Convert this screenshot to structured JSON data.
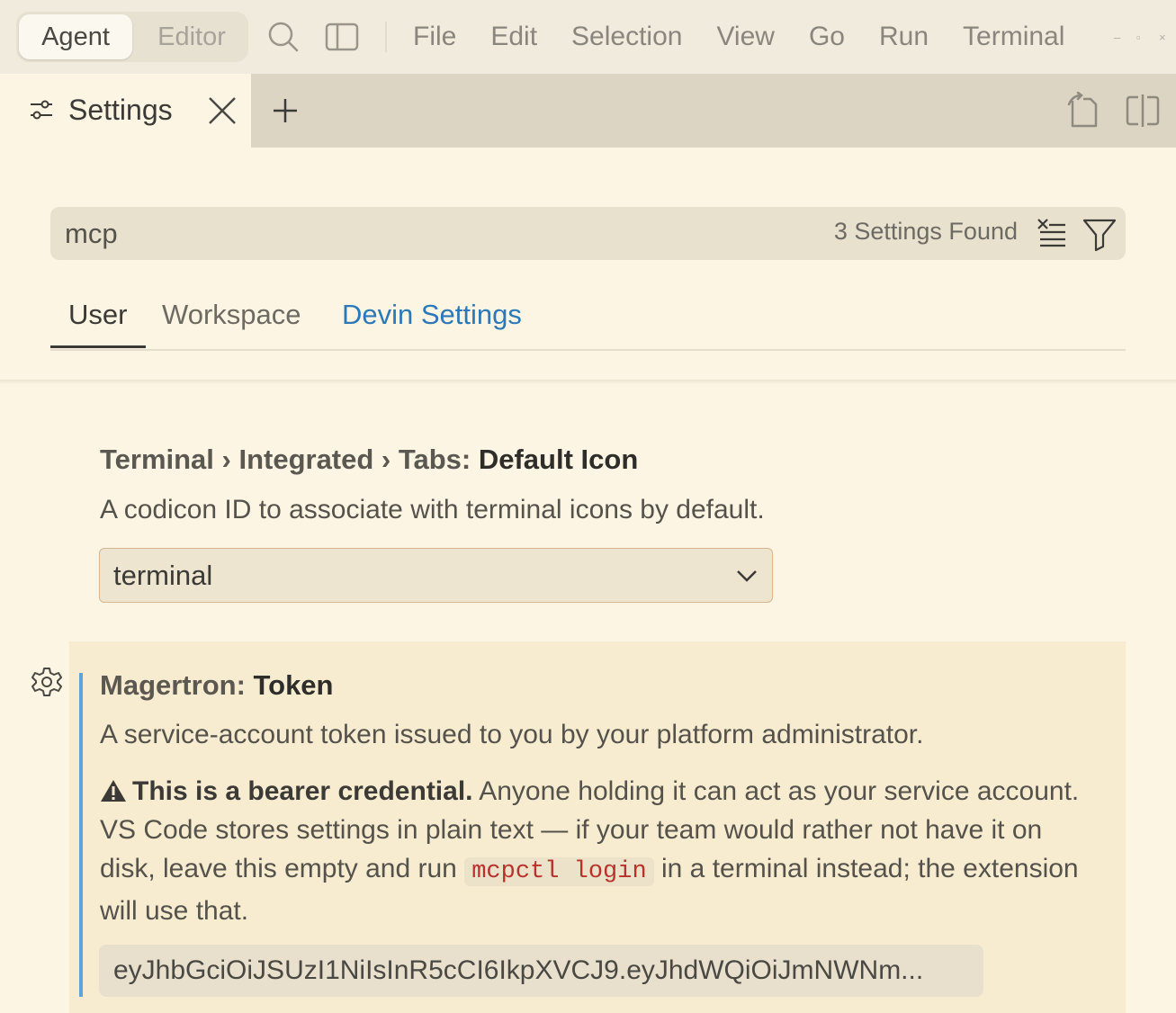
{
  "titlebar": {
    "mode_agent": "Agent",
    "mode_editor": "Editor",
    "menu": [
      "File",
      "Edit",
      "Selection",
      "View",
      "Go",
      "Run",
      "Terminal"
    ],
    "window_controls": {
      "minimize": "–",
      "maximize": "▫",
      "close": "×"
    }
  },
  "tab": {
    "label": "Settings",
    "icons": {
      "settings": "sliders-icon",
      "close": "close-icon",
      "add": "plus-icon",
      "open_json": "open-file-icon",
      "split": "split-editor-icon"
    }
  },
  "search": {
    "value": "mcp",
    "results_count": "3 Settings Found",
    "icons": {
      "clear": "clear-filter-icon",
      "filter": "filter-icon"
    }
  },
  "scopes": {
    "user": "User",
    "workspace": "Workspace",
    "devin": "Devin Settings",
    "active": "User"
  },
  "settings": [
    {
      "category": "Terminal › Integrated › Tabs: ",
      "name": "Default Icon",
      "description": "A codicon ID to associate with terminal icons by default.",
      "value": "terminal"
    },
    {
      "category": "Magertron: ",
      "name": "Token",
      "description": "A service-account token issued to you by your platform administrator.",
      "warning_bold": "This is a bearer credential.",
      "warning_text_1": " Anyone holding it can act as your service account. VS Code stores settings in plain text — if your team would rather not have it on disk, leave this empty and run ",
      "warning_code": "mcpctl login",
      "warning_text_2": " in a terminal instead; the extension will use that.",
      "value": "eyJhbGciOiJSUzI1NiIsInR5cCI6IkpXVCJ9.eyJhdWQiOiJmNWNm..."
    }
  ],
  "colors": {
    "background": "#fcf5e3",
    "link": "#2d78b8",
    "focus_bar": "#5aa6dc",
    "code": "#b8322c"
  }
}
